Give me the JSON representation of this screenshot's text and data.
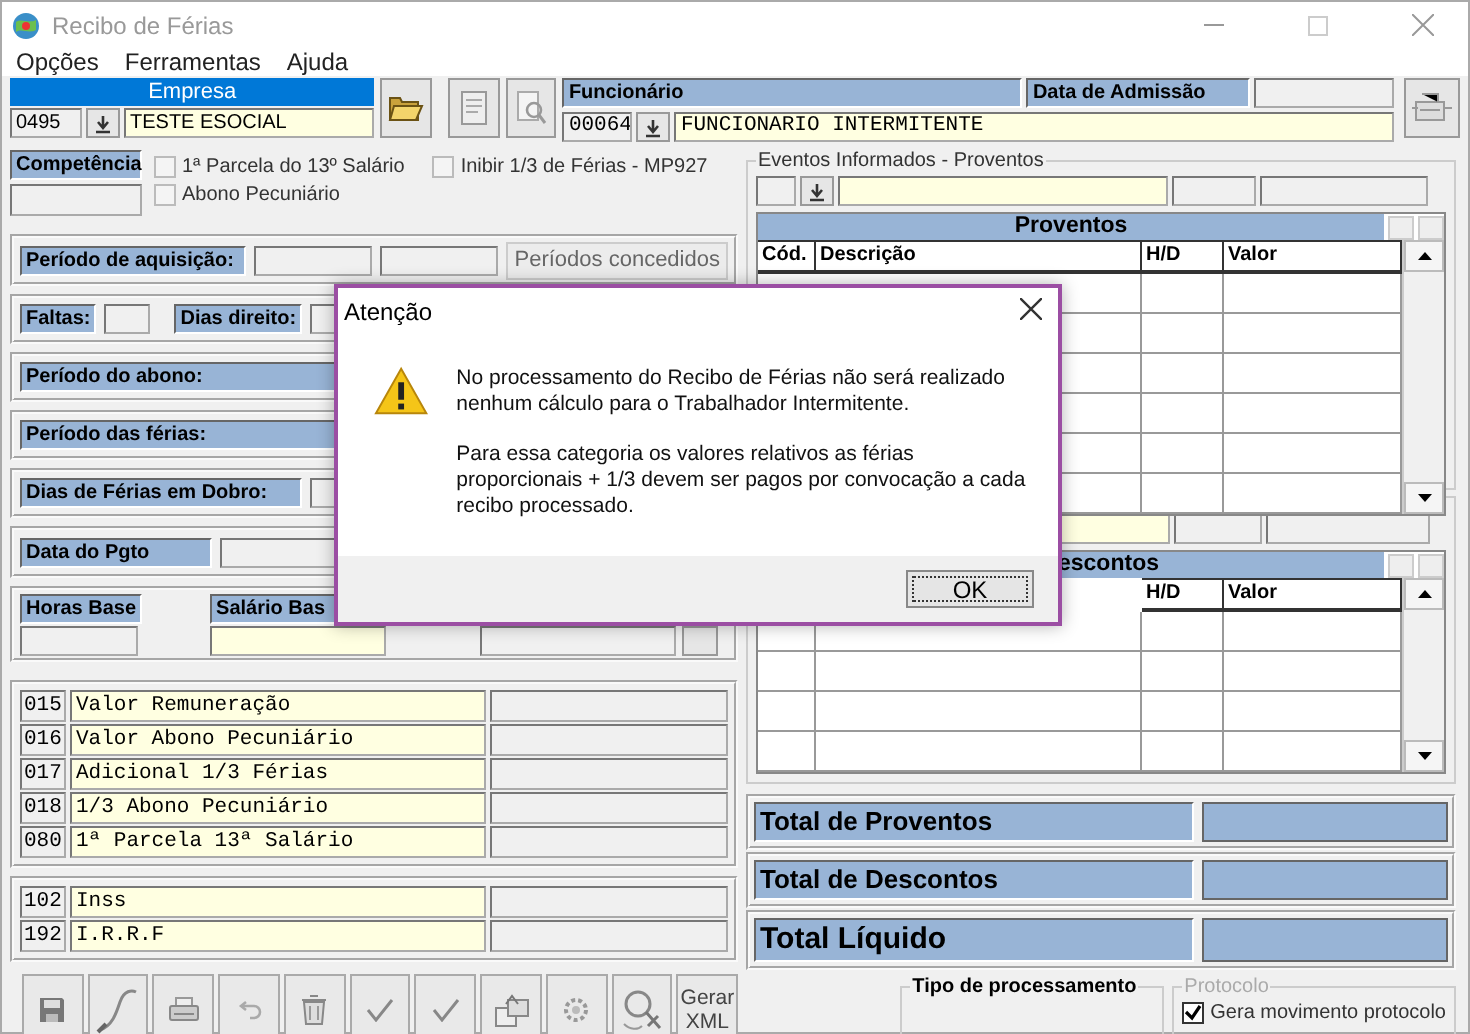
{
  "window": {
    "title": "Recibo de Férias"
  },
  "menu": [
    "Opções",
    "Ferramentas",
    "Ajuda"
  ],
  "empresa": {
    "label": "Empresa",
    "code": "0495",
    "name": "TESTE ESOCIAL"
  },
  "funcionario": {
    "label": "Funcionário",
    "code": "00064",
    "name": "FUNCIONARIO INTERMITENTE",
    "admission_label": "Data de Admissão"
  },
  "competencia": {
    "label": "Competência"
  },
  "options": [
    {
      "label": "1ª Parcela do 13º Salário",
      "checked": false
    },
    {
      "label": "Abono Pecuniário",
      "checked": false
    },
    {
      "label": "Inibir 1/3 de Férias - MP927",
      "checked": false
    }
  ],
  "periodo_aquisicao": {
    "label": "Período de aquisição:",
    "button": "Períodos concedidos"
  },
  "faltas": {
    "label": "Faltas:",
    "dias_direito_label": "Dias direito:"
  },
  "periodos": [
    {
      "label": "Período do abono:"
    },
    {
      "label": "Período das férias:"
    }
  ],
  "dias_dobro": {
    "label": "Dias de Férias em Dobro:"
  },
  "data_pgto": {
    "label": "Data do Pgto"
  },
  "base": {
    "horas_label": "Horas Base",
    "salario_label": "Salário Bas"
  },
  "proventos_items": [
    {
      "code": "015",
      "description": "Valor Remuneração"
    },
    {
      "code": "016",
      "description": "Valor Abono Pecuniário"
    },
    {
      "code": "017",
      "description": "Adicional 1/3 Férias"
    },
    {
      "code": "018",
      "description": "1/3 Abono Pecuniário"
    },
    {
      "code": "080",
      "description": "1ª Parcela 13ª Salário"
    }
  ],
  "descontos_items": [
    {
      "code": "102",
      "description": "Inss"
    },
    {
      "code": "192",
      "description": "I.R.R.F"
    }
  ],
  "toolbar": [
    {
      "kind": "save"
    },
    {
      "kind": "signature"
    },
    {
      "kind": "print"
    },
    {
      "kind": "undo"
    },
    {
      "kind": "trash"
    },
    {
      "kind": "check"
    },
    {
      "kind": "check"
    },
    {
      "kind": "export"
    },
    {
      "kind": "gear"
    },
    {
      "kind": "search"
    },
    {
      "kind": "text",
      "label": "Gerar XML"
    }
  ],
  "eventos_proventos": {
    "legend": "Eventos Informados - Proventos",
    "table_title": "Proventos",
    "columns": [
      "Cód.",
      "Descrição",
      "H/D",
      "Valor"
    ]
  },
  "eventos_descontos": {
    "table_title": "escontos",
    "columns": [
      "H/D",
      "Valor"
    ]
  },
  "totals": [
    {
      "label": "Total de Proventos",
      "kind": "sub"
    },
    {
      "label": "Total de Descontos",
      "kind": "sub"
    },
    {
      "label": "Total Líquido",
      "kind": "grand"
    }
  ],
  "tipo_processamento": {
    "legend": "Tipo de processamento"
  },
  "protocolo": {
    "legend": "Protocolo",
    "disabled": true,
    "option": {
      "label": "Gera movimento protocolo",
      "checked": true
    }
  },
  "dialog": {
    "title": "Atenção",
    "paragraphs": [
      "No processamento do Recibo de Férias não será realizado nenhum cálculo para o Trabalhador Intermitente.",
      "Para essa categoria os valores relativos as férias proporcionais + 1/3 devem ser pagos por convocação a cada recibo processado."
    ],
    "button": "OK"
  }
}
